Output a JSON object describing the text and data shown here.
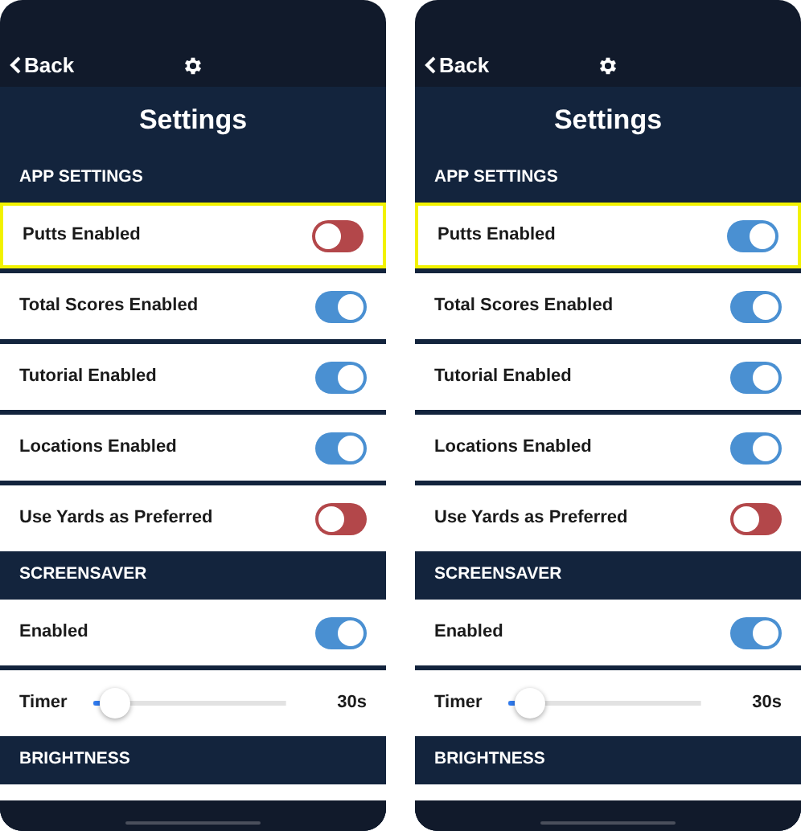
{
  "screens": [
    {
      "back": "Back",
      "title": "Settings",
      "sections": [
        {
          "heading": "APP SETTINGS",
          "rows": [
            {
              "kind": "toggle",
              "label": "Putts Enabled",
              "on": false,
              "highlighted": true
            },
            {
              "kind": "toggle",
              "label": "Total Scores Enabled",
              "on": true,
              "highlighted": false
            },
            {
              "kind": "toggle",
              "label": "Tutorial Enabled",
              "on": true,
              "highlighted": false
            },
            {
              "kind": "toggle",
              "label": "Locations Enabled",
              "on": true,
              "highlighted": false
            },
            {
              "kind": "toggle",
              "label": "Use Yards as Preferred",
              "on": false,
              "highlighted": false
            }
          ]
        },
        {
          "heading": "SCREENSAVER",
          "rows": [
            {
              "kind": "toggle",
              "label": "Enabled",
              "on": true,
              "highlighted": false
            },
            {
              "kind": "slider",
              "label": "Timer",
              "level": 0.08,
              "reading": "30s",
              "highlighted": false
            }
          ]
        },
        {
          "heading": "BRIGHTNESS",
          "partial_row": true
        }
      ]
    },
    {
      "back": "Back",
      "title": "Settings",
      "sections": [
        {
          "heading": "APP SETTINGS",
          "rows": [
            {
              "kind": "toggle",
              "label": "Putts Enabled",
              "on": true,
              "highlighted": true
            },
            {
              "kind": "toggle",
              "label": "Total Scores Enabled",
              "on": true,
              "highlighted": false
            },
            {
              "kind": "toggle",
              "label": "Tutorial Enabled",
              "on": true,
              "highlighted": false
            },
            {
              "kind": "toggle",
              "label": "Locations Enabled",
              "on": true,
              "highlighted": false
            },
            {
              "kind": "toggle",
              "label": "Use Yards as Preferred",
              "on": false,
              "highlighted": false
            }
          ]
        },
        {
          "heading": "SCREENSAVER",
          "rows": [
            {
              "kind": "toggle",
              "label": "Enabled",
              "on": true,
              "highlighted": false
            },
            {
              "kind": "slider",
              "label": "Timer",
              "level": 0.08,
              "reading": "30s",
              "highlighted": false
            }
          ]
        },
        {
          "heading": "BRIGHTNESS",
          "partial_row": true
        }
      ]
    }
  ]
}
